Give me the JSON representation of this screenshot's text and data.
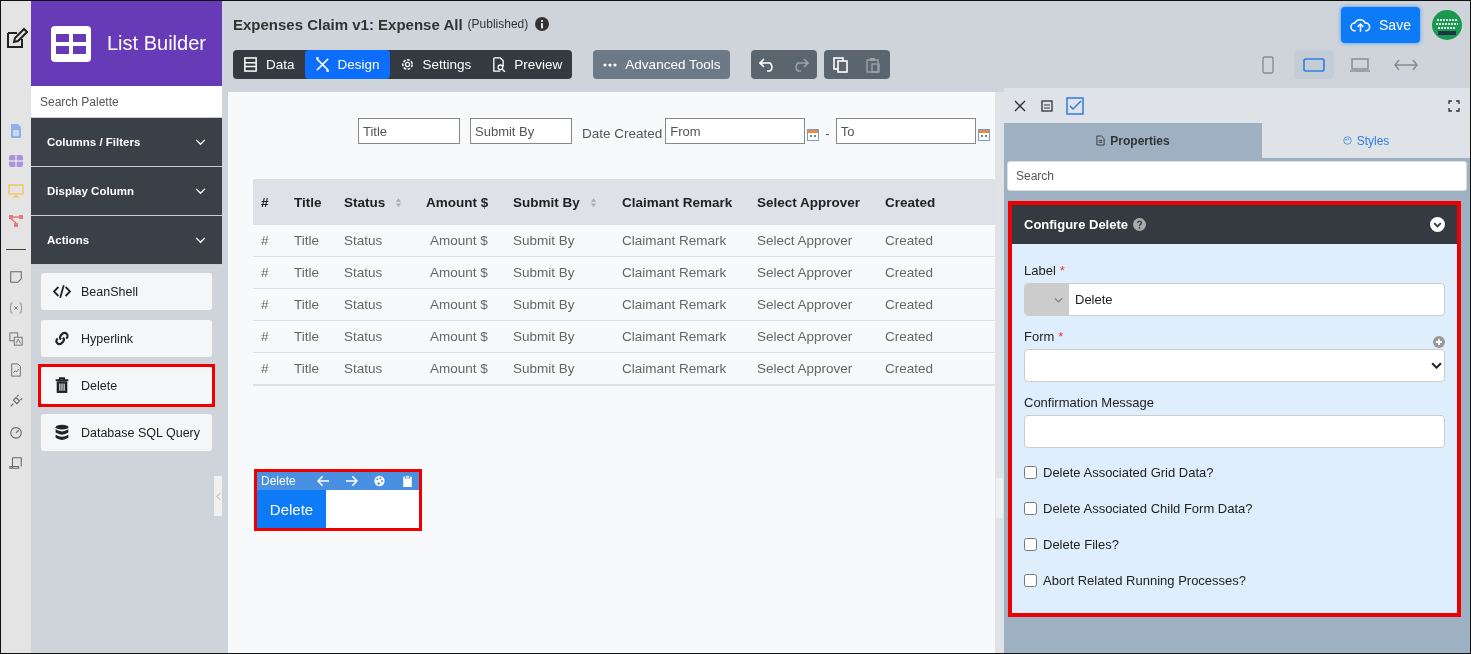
{
  "app": {
    "title": "List Builder"
  },
  "palette": {
    "search_placeholder": "Search Palette",
    "sections": [
      {
        "label": "Columns / Filters"
      },
      {
        "label": "Display Column"
      },
      {
        "label": "Actions"
      }
    ],
    "items": [
      {
        "label": "BeanShell",
        "highlighted": false
      },
      {
        "label": "Hyperlink",
        "highlighted": false
      },
      {
        "label": "Delete",
        "highlighted": true
      },
      {
        "label": "Database SQL Query",
        "highlighted": false
      }
    ]
  },
  "header": {
    "title": "Expenses Claim v1: Expense All",
    "status": "(Published)"
  },
  "mode_tabs": [
    {
      "label": "Data",
      "selected": false
    },
    {
      "label": "Design",
      "selected": true
    },
    {
      "label": "Settings",
      "selected": false
    },
    {
      "label": "Preview",
      "selected": false
    }
  ],
  "advanced_tools": "Advanced Tools",
  "save": "Save",
  "devices": [
    {
      "selected": false
    },
    {
      "selected": true
    },
    {
      "selected": false
    },
    {
      "selected": false
    }
  ],
  "filters": [
    {
      "kind": "text",
      "placeholder": "Title"
    },
    {
      "kind": "text",
      "placeholder": "Submit By"
    },
    {
      "kind": "date_range",
      "label": "Date Created",
      "from_placeholder": "From",
      "separator": "-",
      "to_placeholder": "To"
    }
  ],
  "table": {
    "columns": [
      {
        "label": "#",
        "sortable": false
      },
      {
        "label": "Title",
        "sortable": false
      },
      {
        "label": "Status",
        "sortable": true
      },
      {
        "label": "Amount $",
        "sortable": false
      },
      {
        "label": "Submit By",
        "sortable": true
      },
      {
        "label": "Claimant Remark",
        "sortable": false
      },
      {
        "label": "Select Approver",
        "sortable": false
      },
      {
        "label": "Created",
        "sortable": false
      }
    ],
    "rows": [
      [
        "#",
        "Title",
        "Status",
        "Amount $",
        "Submit By",
        "Claimant Remark",
        "Select Approver",
        "Created"
      ],
      [
        "#",
        "Title",
        "Status",
        "Amount $",
        "Submit By",
        "Claimant Remark",
        "Select Approver",
        "Created"
      ],
      [
        "#",
        "Title",
        "Status",
        "Amount $",
        "Submit By",
        "Claimant Remark",
        "Select Approver",
        "Created"
      ],
      [
        "#",
        "Title",
        "Status",
        "Amount $",
        "Submit By",
        "Claimant Remark",
        "Select Approver",
        "Created"
      ],
      [
        "#",
        "Title",
        "Status",
        "Amount $",
        "Submit By",
        "Claimant Remark",
        "Select Approver",
        "Created"
      ]
    ]
  },
  "selected_element": {
    "title": "Delete",
    "button": "Delete",
    "highlighted": true
  },
  "properties": {
    "tabs": [
      {
        "label": "Properties",
        "selected": true
      },
      {
        "label": "Styles",
        "selected": false
      }
    ],
    "search_placeholder": "Search",
    "section": {
      "title": "Configure Delete",
      "highlighted": true,
      "fields": [
        {
          "kind": "text",
          "label": "Label",
          "required_mark": "*",
          "value": "Delete"
        },
        {
          "kind": "select",
          "label": "Form",
          "required_mark": "*"
        },
        {
          "kind": "textarea",
          "label": "Confirmation Message"
        }
      ],
      "checkboxes": [
        {
          "label": "Delete Associated Grid Data?",
          "checked": false
        },
        {
          "label": "Delete Associated Child Form Data?",
          "checked": false
        },
        {
          "label": "Delete Files?",
          "checked": false
        },
        {
          "label": "Abort Related Running Processes?",
          "checked": false
        }
      ]
    }
  }
}
